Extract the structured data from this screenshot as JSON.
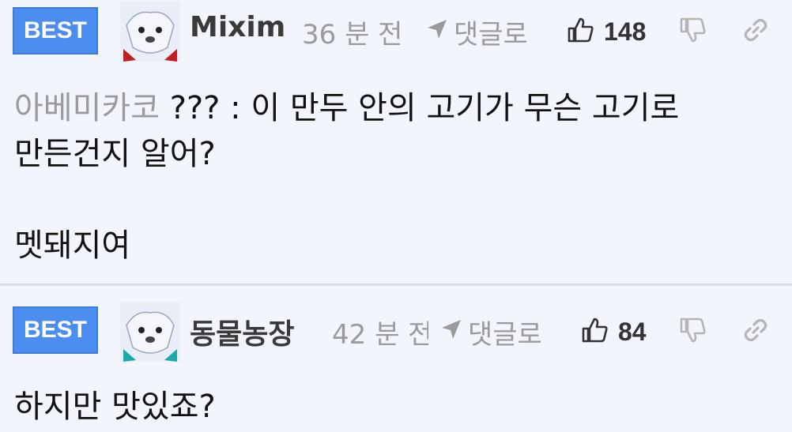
{
  "comments": [
    {
      "badge": "BEST",
      "username": "Mixim",
      "time": "36 분 전",
      "reply_label": "댓글로",
      "likes": "148",
      "mention": "아베미카코",
      "body_line1": "??? : 이 만두 안의 고기가 무슨 고기로",
      "body_line2": "만든건지 알어?",
      "body_line3": "멧돼지여"
    },
    {
      "badge": "BEST",
      "username": "동물농장",
      "time": "42 분 전",
      "reply_label": "댓글로",
      "likes": "84",
      "body_line1": "하지만 맛있죠?"
    }
  ],
  "icons": {
    "reply": "reply-arrow-icon",
    "like": "thumbs-up-icon",
    "dislike": "thumbs-down-icon",
    "link": "link-icon"
  },
  "colors": {
    "background": "#f3f5fd",
    "badge": "#4c8df0",
    "muted_text": "#9b9b9b"
  }
}
